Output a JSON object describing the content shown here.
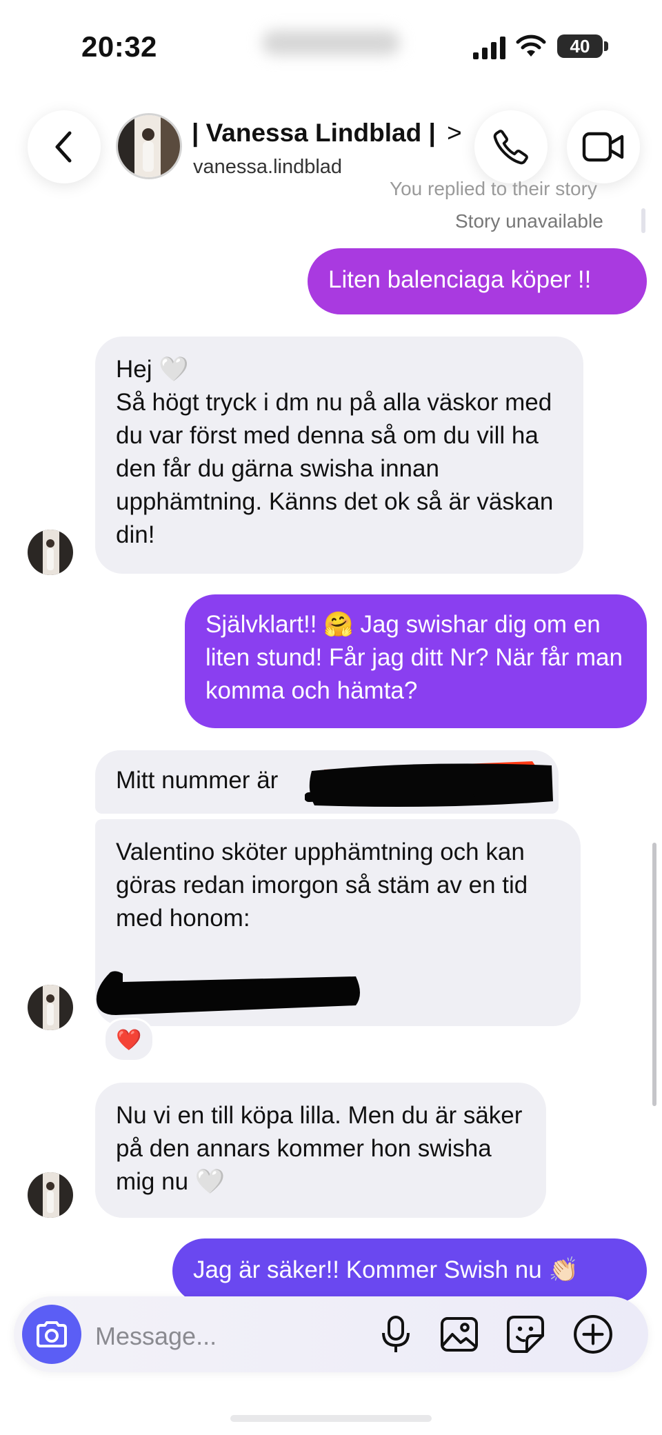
{
  "status_bar": {
    "time": "20:32",
    "battery": "40"
  },
  "header": {
    "name": "| Vanessa Lindblad |",
    "chevron": ">",
    "handle": "vanessa.lindblad"
  },
  "story": {
    "replied": "You replied to their story",
    "unavailable": "Story unavailable"
  },
  "messages": [
    {
      "side": "out",
      "text": "Liten balenciaga köper !!"
    },
    {
      "side": "in",
      "text": "Hej 🤍\nSå högt tryck i dm nu på alla väskor med du var först med denna så om du vill ha den får du gärna swisha innan upphämtning. Känns det ok så är väskan din!"
    },
    {
      "side": "out",
      "text": "Självklart!! 🤗 Jag swishar dig om en liten stund! Får jag ditt Nr? När får man komma och hämta?"
    },
    {
      "side": "in",
      "text": "Mitt nummer är"
    },
    {
      "side": "in",
      "text": "Valentino sköter upphämtning och kan göras redan imorgon så stäm av en tid med honom:",
      "reaction": "❤️"
    },
    {
      "side": "in",
      "text": "Nu vi en till köpa lilla. Men du är säker på den annars kommer hon swisha mig nu 🤍"
    },
    {
      "side": "out",
      "text": "Jag är säker!! Kommer Swish nu 👏🏻"
    }
  ],
  "composer": {
    "placeholder": "Message..."
  },
  "colors": {
    "bubble_out_1": "#a93ae0",
    "bubble_out_2": "#8a3ff0",
    "bubble_out_3": "#6a48f0",
    "bubble_in": "#efeff4",
    "camera": "#5b5ef5"
  },
  "icons": [
    "back-chevron-icon",
    "phone-icon",
    "video-camera-icon",
    "camera-icon",
    "microphone-icon",
    "gallery-icon",
    "sticker-icon",
    "plus-circle-icon"
  ]
}
